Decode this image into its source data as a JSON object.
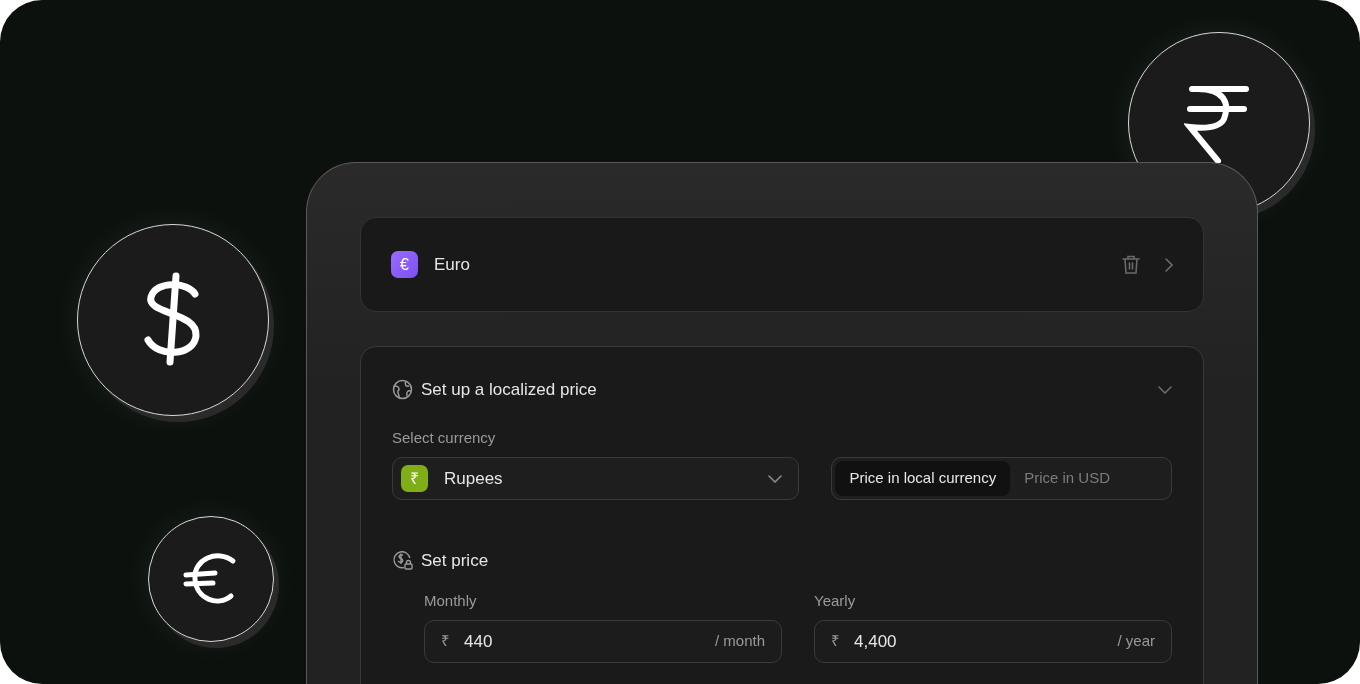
{
  "currency_row": {
    "symbol": "€",
    "name": "Euro"
  },
  "localized_price": {
    "title": "Set up a localized price",
    "expanded": true,
    "select_label": "Select currency",
    "select": {
      "symbol": "₹",
      "value": "Rupees"
    },
    "price_mode": [
      {
        "label": "Price in local currency",
        "selected": true
      },
      {
        "label": "Price in USD",
        "selected": false
      }
    ],
    "set_price_title": "Set price",
    "fields": [
      {
        "label": "Monthly",
        "prefix": "₹",
        "value": "440",
        "suffix": "/ month"
      },
      {
        "label": "Yearly",
        "prefix": "₹",
        "value": "4,400",
        "suffix": "/ year"
      }
    ]
  }
}
